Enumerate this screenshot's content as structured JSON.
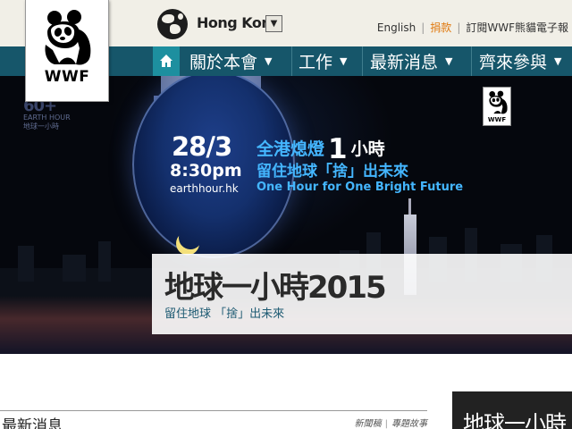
{
  "header": {
    "region": "Hong Kong",
    "region_dropdown_icon": "▼",
    "links": [
      "English",
      "捐款",
      "訂閱WWF熊貓電子報"
    ]
  },
  "logo": {
    "text": "WWF",
    "icon": "panda-icon"
  },
  "nav": {
    "home_icon": "home-icon",
    "items": [
      {
        "label": "關於本會",
        "caret": "▼"
      },
      {
        "label": "工作",
        "caret": "▼"
      },
      {
        "label": "最新消息",
        "caret": "▼"
      },
      {
        "label": "齊來參與",
        "caret": "▼"
      }
    ]
  },
  "hero": {
    "date": "28/3",
    "time": "8:30pm",
    "url": "earthhour.hk",
    "zh_line1_a": "全港熄燈",
    "zh_line1_num": "1",
    "zh_line1_b": "小時",
    "zh_line2": "留住地球「捨」出未來",
    "en_line": "One Hour for One Bright Future",
    "caption_title": "地球一小時2015",
    "caption_subtitle": "留住地球 「捨」出未來"
  },
  "news": {
    "title": "最新消息",
    "links": [
      "新聞稿",
      "專題故事"
    ]
  },
  "feature": {
    "title": "地球一小時"
  },
  "colors": {
    "nav_bg": "#16566a",
    "nav_home": "#1d8f9f",
    "accent_blue": "#44b6ff",
    "donate": "#e07a10"
  }
}
